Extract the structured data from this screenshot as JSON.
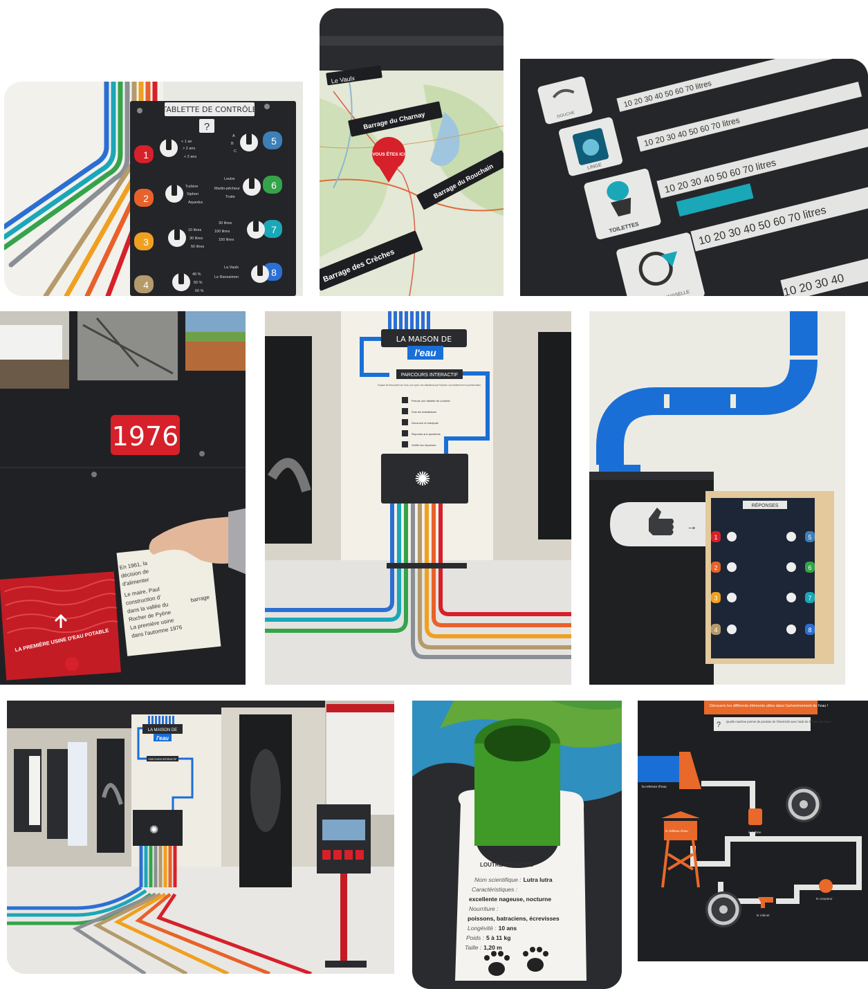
{
  "gallery": {
    "photo1": {
      "panel_title": "TABLETTE DE CONTRÔLE",
      "question_mark": "?",
      "numbers": [
        "1",
        "2",
        "3",
        "4",
        "5",
        "6",
        "7",
        "8"
      ],
      "knob_labels": {
        "k1": [
          "< 1 an",
          "> 2 ans",
          "< 2 ans"
        ],
        "k2": [
          "Turbine",
          "Siphon",
          "Aqueduc"
        ],
        "k3": [
          "10 litres",
          "30 litres",
          "50 litres"
        ],
        "k4": [
          "40 %",
          "50 %",
          "60 %"
        ],
        "k5": [
          "A",
          "B",
          "C"
        ],
        "k6": [
          "Loutre",
          "Martin-pêcheur",
          "Truite"
        ],
        "k7": [
          "30 litres",
          "100 litres",
          "150 litres"
        ],
        "k8": [
          "La Vaulx",
          "Le Ranssimon"
        ]
      }
    },
    "photo2": {
      "labels": [
        "Le Vaulx",
        "Barrage du Charnay",
        "Barrage du Rouchain",
        "Barrage des Crèches"
      ],
      "pin_text": "VOUS ÊTES ICI"
    },
    "photo3": {
      "rows": [
        {
          "label": "DOUCHE",
          "scale": "10 20 30 40 50 60 70 litres"
        },
        {
          "label": "LINGE",
          "scale": "10 20 30 40 50 60 70 litres"
        },
        {
          "label": "TOILETTES",
          "scale": "10 20 30 40 50 60 70 litres"
        },
        {
          "label": "VAISSELLE",
          "scale": "10 20 30 40"
        }
      ]
    },
    "photo4": {
      "year": "1976",
      "red_panel": "LA PREMIÈRE USINE D'EAU POTABLE",
      "text_lines": [
        "En 1961, la",
        "décision de",
        "d'alimenter",
        "Le maire, Paul",
        "construction d'",
        "dans la vallée du",
        "Rocher de Pyène",
        "La première usine",
        "dans l'automne 1976"
      ],
      "text_tail": "barrage"
    },
    "photo5": {
      "title_top": "LA MAISON DE",
      "title_main": "l'eau",
      "subtitle": "PARCOURS INTERACTIF",
      "intro": "Espace de découverte sur l'eau, son cycle, ses utilisations par l'homme, son traitement et sa préservation.",
      "steps": [
        "Prends une tablette de contrôle",
        "Suis les installations",
        "Découvre et manipule",
        "Réponds aux questions",
        "Vérifie tes réponses"
      ]
    },
    "photo6": {
      "answers_title": "RÉPONSES",
      "numbers": [
        "1",
        "2",
        "3",
        "4",
        "5",
        "6",
        "7",
        "8"
      ]
    },
    "photo7": {
      "title_top": "LA MAISON DE",
      "title_main": "l'eau",
      "subtitle": "PARCOURS INTERACTIF"
    },
    "photo8": {
      "tag_title": "LOUTRE D'EUROPE",
      "name_label": "Nom scientifique :",
      "name_value": "Lutra lutra",
      "traits_label": "Caractéristiques :",
      "traits_value": "excellente nageuse, nocturne",
      "food_label": "Nourriture :",
      "food_value": "poissons, batraciens, écrevisses",
      "life_label": "Longévité :",
      "life_value": "10 ans",
      "weight_label": "Poids :",
      "weight_value": "5 à 11 kg",
      "size_label": "Taille :",
      "size_value": "1,20 m"
    },
    "photo9": {
      "header": "Découvre les différents éléments utiles dans l'acheminement de l'eau !",
      "question": "Quelle machine permet de produire de l'électricité avec l'aide de la force de l'eau ?",
      "q_mark": "?",
      "labels": [
        "la retenue d'eau",
        "le château d'eau",
        "la turbine",
        "le robinet",
        "le compteur"
      ]
    }
  },
  "colors": {
    "pipe_blue": "#1a6fd6",
    "panel_dark": "#222326",
    "accent_red": "#d6202a",
    "accent_orange": "#e8692a",
    "pipe_stripes": [
      "#2b6fd2",
      "#1aa7b8",
      "#35a34a",
      "#8a8f95",
      "#b59a6b",
      "#f0a020",
      "#e8612a",
      "#d6202a"
    ]
  },
  "icons": [
    "shower-icon",
    "washing-machine-icon",
    "toilet-icon",
    "dish-icon",
    "thumbs-up-icon",
    "location-pin-icon",
    "paw-icon",
    "valve-wheel-icon",
    "water-tower-icon",
    "dam-icon",
    "faucet-icon"
  ]
}
